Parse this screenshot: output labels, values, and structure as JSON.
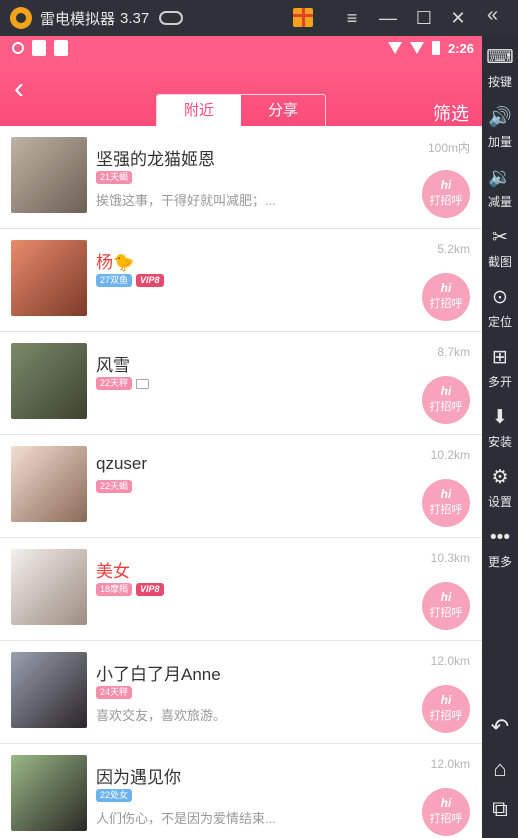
{
  "emulator": {
    "name": "雷电模拟器",
    "version": "3.37",
    "window_buttons": [
      "≡",
      "—",
      "☐",
      "✕"
    ],
    "collapse_glyph": "«",
    "sidebar": [
      {
        "icon": "keyboard-icon",
        "glyph": "⌨",
        "label": "按键"
      },
      {
        "icon": "volume-up-icon",
        "glyph": "🔊",
        "label": "加量"
      },
      {
        "icon": "volume-down-icon",
        "glyph": "🔉",
        "label": "减量"
      },
      {
        "icon": "scissors-icon",
        "glyph": "✂",
        "label": "截图"
      },
      {
        "icon": "location-icon",
        "glyph": "⊙",
        "label": "定位"
      },
      {
        "icon": "multi-open-icon",
        "glyph": "⊞",
        "label": "多开"
      },
      {
        "icon": "apk-install-icon",
        "glyph": "⬇",
        "label": "安装"
      },
      {
        "icon": "settings-icon",
        "glyph": "⚙",
        "label": "设置"
      },
      {
        "icon": "more-icon",
        "glyph": "•••",
        "label": "更多"
      }
    ],
    "nav": [
      {
        "icon": "back-icon",
        "glyph": "↶"
      },
      {
        "icon": "home-icon",
        "glyph": "⌂"
      },
      {
        "icon": "recents-icon",
        "glyph": "⧉"
      }
    ]
  },
  "status_bar": {
    "time": "2:26"
  },
  "header": {
    "back_glyph": "‹",
    "tabs": [
      {
        "label": "附近",
        "active": true
      },
      {
        "label": "分享",
        "active": false
      }
    ],
    "filter_label": "筛选",
    "accent": "#fd5d86"
  },
  "users": [
    {
      "name": "坚强的龙猫姬恩",
      "vip": false,
      "tags": [
        {
          "text": "21天蝎",
          "color": "pink"
        }
      ],
      "extra_icon": false,
      "signature": "挨饿这事，干得好就叫减肥；...",
      "distance": "100m内",
      "action": "打招呼",
      "avatar_colors": [
        "#bfb3a6",
        "#6d6054"
      ]
    },
    {
      "name": "杨",
      "vip": true,
      "emoji": "🐤",
      "tags": [
        {
          "text": "27双鱼",
          "color": "blue"
        },
        {
          "text": "VIP8",
          "color": "vip"
        }
      ],
      "extra_icon": false,
      "signature": "",
      "distance": "5.2km",
      "action": "打招呼",
      "avatar_colors": [
        "#e88b6b",
        "#7d3b2a"
      ]
    },
    {
      "name": "风雪",
      "vip": false,
      "tags": [
        {
          "text": "22天秤",
          "color": "pink"
        }
      ],
      "extra_icon": true,
      "signature": "",
      "distance": "8.7km",
      "action": "打招呼",
      "avatar_colors": [
        "#7b8a6a",
        "#3c4330"
      ]
    },
    {
      "name": "qzuser",
      "vip": false,
      "tags": [
        {
          "text": "22天蝎",
          "color": "pink"
        }
      ],
      "extra_icon": false,
      "signature": "",
      "distance": "10.2km",
      "action": "打招呼",
      "avatar_colors": [
        "#f3ded2",
        "#8a6a58"
      ]
    },
    {
      "name": "美女",
      "vip": true,
      "tags": [
        {
          "text": "18摩羯",
          "color": "pink"
        },
        {
          "text": "VIP8",
          "color": "vip"
        }
      ],
      "extra_icon": false,
      "signature": "",
      "distance": "10.3km",
      "action": "打招呼",
      "avatar_colors": [
        "#f2efec",
        "#9d8d82"
      ]
    },
    {
      "name": "小了白了月Anne",
      "vip": false,
      "tags": [
        {
          "text": "24天秤",
          "color": "pink"
        }
      ],
      "extra_icon": false,
      "signature": "喜欢交友，喜欢旅游。",
      "distance": "12.0km",
      "action": "打招呼",
      "avatar_colors": [
        "#9aa0b0",
        "#2b2628"
      ]
    },
    {
      "name": "因为遇见你",
      "vip": false,
      "tags": [
        {
          "text": "22处女",
          "color": "blue"
        }
      ],
      "extra_icon": false,
      "signature": "人们伤心，不是因为爱情结束...",
      "distance": "12.0km",
      "action": "打招呼",
      "avatar_colors": [
        "#9ab886",
        "#2a2a25"
      ]
    }
  ]
}
